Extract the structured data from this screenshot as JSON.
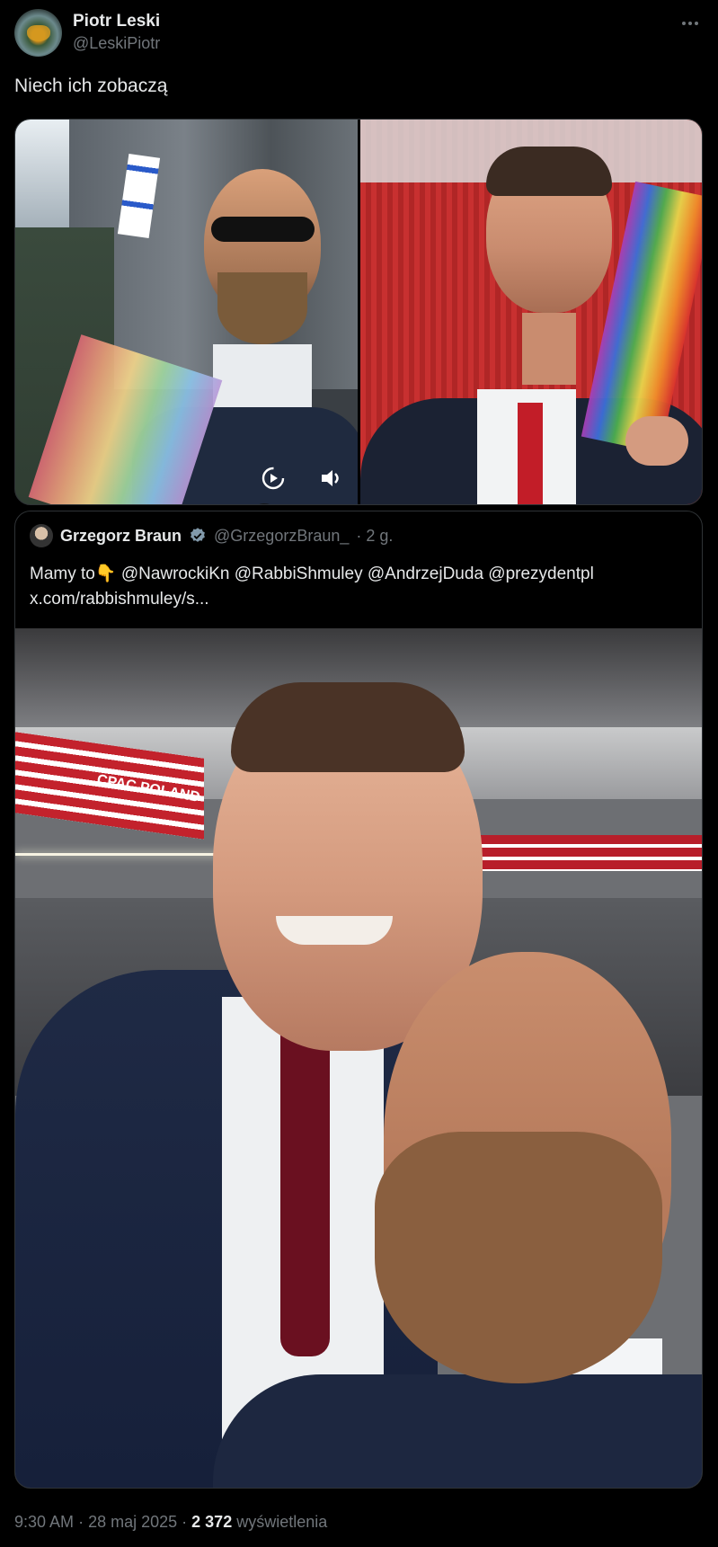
{
  "author": {
    "display_name": "Piotr Leski",
    "handle": "@LeskiPiotr"
  },
  "tweet": {
    "text": "Niech ich zobaczą"
  },
  "quoted": {
    "display_name": "Grzegorz Braun",
    "handle": "@GrzegorzBraun_",
    "time_ago": "· 2 g.",
    "text_prefix": "Mamy to",
    "emoji": "👇",
    "mentions": "@NawrockiKn @RabbiShmuley @AndrzejDuda @prezydentpl",
    "link": "x.com/rabbishmuley/s...",
    "photo_sign": "CPAC POLAND"
  },
  "meta": {
    "time": "9:30 AM",
    "date": "28 maj 2025",
    "views_count": "2 372",
    "views_label": "wyświetlenia"
  },
  "colors": {
    "background": "#000000",
    "text": "#e7e9ea",
    "secondary": "#71767b",
    "verified": "#829aab"
  }
}
